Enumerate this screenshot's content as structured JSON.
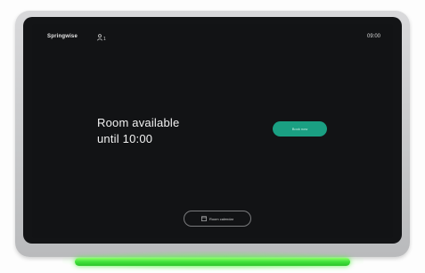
{
  "device": {
    "room_name": "Springwise",
    "time": "09:00",
    "status_line1": "Room available",
    "status_line2": "until 10:00",
    "book_button_label": "Book now",
    "calendar_button_label": "Room calendar",
    "led_color": "#3fe13a",
    "accent_color": "#1a9f82"
  }
}
